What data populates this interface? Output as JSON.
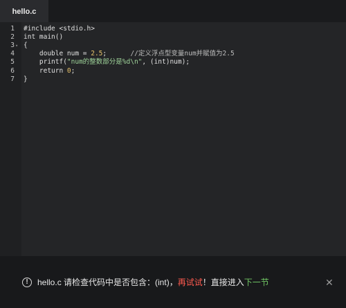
{
  "tab": {
    "title": "hello.c"
  },
  "editor": {
    "lines": [
      {
        "n": "1",
        "fold": "",
        "parts": [
          {
            "t": "#include <stdio.h>",
            "c": "kw"
          }
        ]
      },
      {
        "n": "2",
        "fold": "",
        "parts": [
          {
            "t": "int main()",
            "c": "kw"
          }
        ]
      },
      {
        "n": "3",
        "fold": "▾",
        "parts": [
          {
            "t": "{",
            "c": "kw"
          }
        ]
      },
      {
        "n": "4",
        "fold": "",
        "parts": [
          {
            "t": "    double num = ",
            "c": "kw"
          },
          {
            "t": "2.5",
            "c": "num"
          },
          {
            "t": ";      ",
            "c": "kw"
          },
          {
            "t": "//定义浮点型变量num并赋值为2.5",
            "c": "cmt"
          }
        ]
      },
      {
        "n": "5",
        "fold": "",
        "parts": [
          {
            "t": "    printf(",
            "c": "kw"
          },
          {
            "t": "\"num的整数部分是%d\\n\"",
            "c": "str"
          },
          {
            "t": ", (int)num);",
            "c": "kw"
          }
        ]
      },
      {
        "n": "6",
        "fold": "",
        "parts": [
          {
            "t": "    return ",
            "c": "kw"
          },
          {
            "t": "0",
            "c": "num"
          },
          {
            "t": ";",
            "c": "kw"
          }
        ]
      },
      {
        "n": "7",
        "fold": "",
        "parts": [
          {
            "t": "}",
            "c": "kw"
          }
        ]
      }
    ]
  },
  "notice": {
    "icon": "info-icon",
    "text_prefix": "hello.c 请检查代码中是否包含：(int)，",
    "retry_label": "再试试",
    "text_middle": "！直接进入",
    "next_label": "下一节",
    "close_icon": "close-icon",
    "close_glyph": "✕",
    "info_glyph": "!"
  }
}
